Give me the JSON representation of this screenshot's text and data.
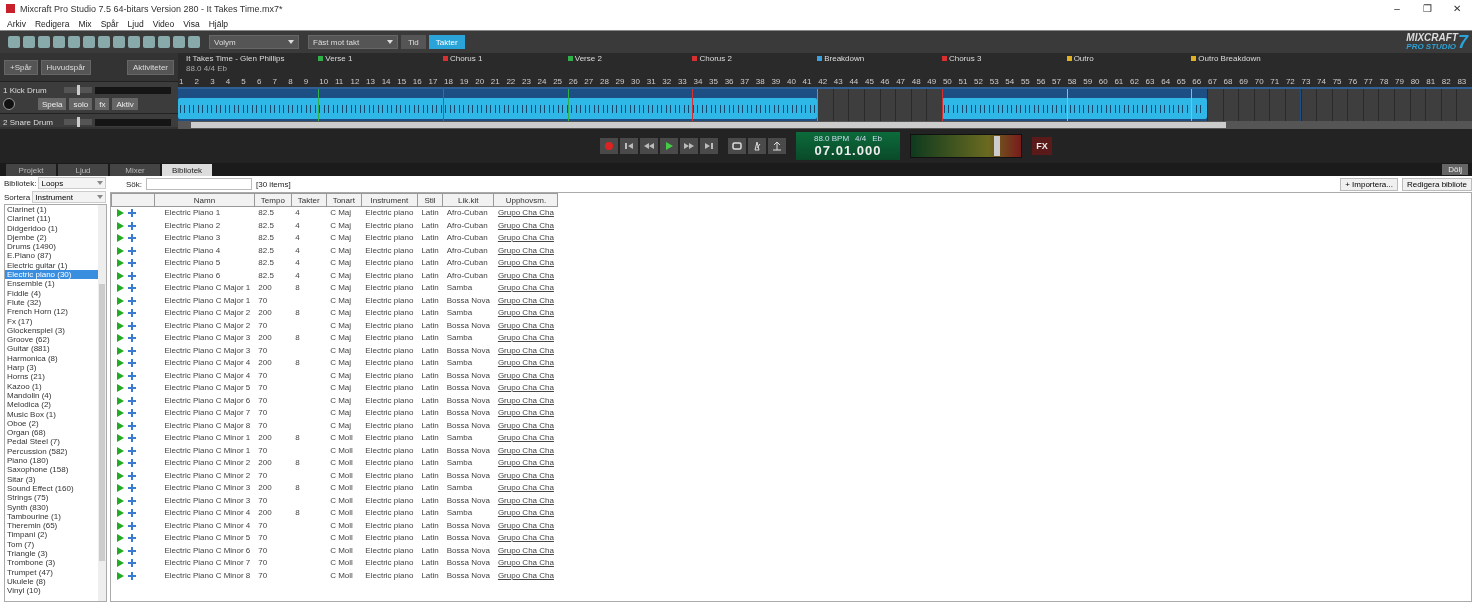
{
  "window": {
    "title": "Mixcraft Pro Studio 7.5 64-bitars Version 280 - It Takes Time.mx7*",
    "controls": [
      "–",
      "❐",
      "✕"
    ]
  },
  "menu": [
    "Arkiv",
    "Redigera",
    "Mix",
    "Spår",
    "Ljud",
    "Video",
    "Visa",
    "Hjälp"
  ],
  "toolbar": {
    "dropdowns": [
      "Volym",
      "Fäst mot takt"
    ],
    "modes": [
      {
        "label": "Tid",
        "selected": false
      },
      {
        "label": "Takter",
        "selected": true
      }
    ],
    "logo": {
      "line1": "MIXCRAFT",
      "line2": "PRO STUDIO",
      "number": "7"
    }
  },
  "track_panel": {
    "buttons": [
      "+Spår",
      "Huvudspår"
    ],
    "activity": "Aktiviteter"
  },
  "tracks": [
    {
      "name": "1 Kick Drum",
      "level": 0.5,
      "buttons": [
        "Spela",
        "solo",
        "fx",
        "Aktiv"
      ]
    },
    {
      "name": "2 Snare Drum",
      "level": 0.5
    }
  ],
  "timeline": {
    "song_title": "It Takes Time - Glen Phillips",
    "song_info": "88.0 4/4 Eb",
    "markers": [
      {
        "label": "Verse 1",
        "color": "#2fb04a"
      },
      {
        "label": "Chorus 1",
        "color": "#d83030"
      },
      {
        "label": "Verse 2",
        "color": "#2fb04a"
      },
      {
        "label": "Chorus 2",
        "color": "#d83030"
      },
      {
        "label": "Breakdown",
        "color": "#3aa0e0"
      },
      {
        "label": "Chorus 3",
        "color": "#d83030"
      },
      {
        "label": "Outro",
        "color": "#e0b020"
      },
      {
        "label": "Outro Breakdown",
        "color": "#e0b020"
      }
    ],
    "ruler": [
      "1",
      "2",
      "3",
      "4",
      "5",
      "6",
      "7",
      "8",
      "9",
      "10",
      "11",
      "12",
      "13",
      "14",
      "15",
      "16",
      "17",
      "18",
      "19",
      "20",
      "21",
      "22",
      "23",
      "24",
      "25",
      "26",
      "27",
      "28",
      "29",
      "30",
      "31",
      "32",
      "33",
      "34",
      "35",
      "36",
      "37",
      "38",
      "39",
      "40",
      "41",
      "42",
      "43",
      "44",
      "45",
      "46",
      "47",
      "48",
      "49",
      "50",
      "51",
      "52",
      "53",
      "54",
      "55",
      "56",
      "57",
      "58",
      "59",
      "60",
      "61",
      "62",
      "63",
      "64",
      "65",
      "66",
      "67",
      "68",
      "69",
      "70",
      "71",
      "72",
      "73",
      "74",
      "75",
      "76",
      "77",
      "78",
      "79",
      "80",
      "81",
      "82",
      "83"
    ]
  },
  "transport": {
    "tempo": "88.0 BPM",
    "meter": "4/4",
    "key": "Eb",
    "time": "07.01.000",
    "master": {
      "level": 0.78
    },
    "fx": "FX"
  },
  "tabs": [
    {
      "label": "Projekt",
      "selected": false
    },
    {
      "label": "Ljud",
      "selected": false
    },
    {
      "label": "Mixer",
      "selected": false
    },
    {
      "label": "Bibliotek",
      "selected": true
    }
  ],
  "hide_button": "Dölj",
  "library": {
    "library_label": "Bibliotek:",
    "library_value": "Loops",
    "sort_label": "Sortera",
    "sort_value": "Instrument",
    "search_label": "Sök:",
    "count": "[30 items]",
    "import": "+ Importera...",
    "edit": "Redigera bibliote",
    "categories": [
      {
        "label": "Clarinet (1)",
        "selected": false
      },
      {
        "label": "Clarinet (11)",
        "selected": false
      },
      {
        "label": "Didgeridoo (1)",
        "selected": false
      },
      {
        "label": "Djembe (2)",
        "selected": false
      },
      {
        "label": "Drums (1490)",
        "selected": false
      },
      {
        "label": "E.Piano (87)",
        "selected": false
      },
      {
        "label": "Electric guitar (1)",
        "selected": false
      },
      {
        "label": "Electric piano (30)",
        "selected": true
      },
      {
        "label": "Ensemble (1)",
        "selected": false
      },
      {
        "label": "Fiddle (4)",
        "selected": false
      },
      {
        "label": "Flute (32)",
        "selected": false
      },
      {
        "label": "French Horn (12)",
        "selected": false
      },
      {
        "label": "Fx (17)",
        "selected": false
      },
      {
        "label": "Glockenspiel (3)",
        "selected": false
      },
      {
        "label": "Groove (62)",
        "selected": false
      },
      {
        "label": "Guitar (881)",
        "selected": false
      },
      {
        "label": "Harmonica (8)",
        "selected": false
      },
      {
        "label": "Harp (3)",
        "selected": false
      },
      {
        "label": "Horns (21)",
        "selected": false
      },
      {
        "label": "Kazoo (1)",
        "selected": false
      },
      {
        "label": "Mandolin (4)",
        "selected": false
      },
      {
        "label": "Melodica (2)",
        "selected": false
      },
      {
        "label": "Music Box (1)",
        "selected": false
      },
      {
        "label": "Oboe (2)",
        "selected": false
      },
      {
        "label": "Organ (68)",
        "selected": false
      },
      {
        "label": "Pedal Steel (7)",
        "selected": false
      },
      {
        "label": "Percussion (582)",
        "selected": false
      },
      {
        "label": "Piano (180)",
        "selected": false
      },
      {
        "label": "Saxophone (158)",
        "selected": false
      },
      {
        "label": "Sitar (3)",
        "selected": false
      },
      {
        "label": "Sound Effect (160)",
        "selected": false
      },
      {
        "label": "Strings (75)",
        "selected": false
      },
      {
        "label": "Synth (830)",
        "selected": false
      },
      {
        "label": "Tambourine (1)",
        "selected": false
      },
      {
        "label": "Theremin (65)",
        "selected": false
      },
      {
        "label": "Timpani (2)",
        "selected": false
      },
      {
        "label": "Tom (7)",
        "selected": false
      },
      {
        "label": "Triangle (3)",
        "selected": false
      },
      {
        "label": "Trombone (3)",
        "selected": false
      },
      {
        "label": "Trumpet (47)",
        "selected": false
      },
      {
        "label": "Ukulele (8)",
        "selected": false
      },
      {
        "label": "Vinyl (10)",
        "selected": false
      }
    ],
    "columns": [
      "Namn",
      "Tempo",
      "Takter",
      "Tonart",
      "Instrument",
      "Stil",
      "Lik.kit",
      "Upphovsm."
    ],
    "rows": [
      [
        "Electric Piano 1",
        "82.5",
        "4",
        "C Maj",
        "Electric piano",
        "Latin",
        "Afro-Cuban",
        "Grupo Cha Cha"
      ],
      [
        "Electric Piano 2",
        "82.5",
        "4",
        "C Maj",
        "Electric piano",
        "Latin",
        "Afro-Cuban",
        "Grupo Cha Cha"
      ],
      [
        "Electric Piano 3",
        "82.5",
        "4",
        "C Maj",
        "Electric piano",
        "Latin",
        "Afro-Cuban",
        "Grupo Cha Cha"
      ],
      [
        "Electric Piano 4",
        "82.5",
        "4",
        "C Maj",
        "Electric piano",
        "Latin",
        "Afro-Cuban",
        "Grupo Cha Cha"
      ],
      [
        "Electric Piano 5",
        "82.5",
        "4",
        "C Maj",
        "Electric piano",
        "Latin",
        "Afro-Cuban",
        "Grupo Cha Cha"
      ],
      [
        "Electric Piano 6",
        "82.5",
        "4",
        "C Maj",
        "Electric piano",
        "Latin",
        "Afro-Cuban",
        "Grupo Cha Cha"
      ],
      [
        "Electric Piano C Major 1",
        "200",
        "8",
        "C Maj",
        "Electric piano",
        "Latin",
        "Samba",
        "Grupo Cha Cha"
      ],
      [
        "Electric Piano C Major 1",
        "70",
        "",
        "C Maj",
        "Electric piano",
        "Latin",
        "Bossa Nova",
        "Grupo Cha Cha"
      ],
      [
        "Electric Piano C Major 2",
        "200",
        "8",
        "C Maj",
        "Electric piano",
        "Latin",
        "Samba",
        "Grupo Cha Cha"
      ],
      [
        "Electric Piano C Major 2",
        "70",
        "",
        "C Maj",
        "Electric piano",
        "Latin",
        "Bossa Nova",
        "Grupo Cha Cha"
      ],
      [
        "Electric Piano C Major 3",
        "200",
        "8",
        "C Maj",
        "Electric piano",
        "Latin",
        "Samba",
        "Grupo Cha Cha"
      ],
      [
        "Electric Piano C Major 3",
        "70",
        "",
        "C Maj",
        "Electric piano",
        "Latin",
        "Bossa Nova",
        "Grupo Cha Cha"
      ],
      [
        "Electric Piano C Major 4",
        "200",
        "8",
        "C Maj",
        "Electric piano",
        "Latin",
        "Samba",
        "Grupo Cha Cha"
      ],
      [
        "Electric Piano C Major 4",
        "70",
        "",
        "C Maj",
        "Electric piano",
        "Latin",
        "Bossa Nova",
        "Grupo Cha Cha"
      ],
      [
        "Electric Piano C Major 5",
        "70",
        "",
        "C Maj",
        "Electric piano",
        "Latin",
        "Bossa Nova",
        "Grupo Cha Cha"
      ],
      [
        "Electric Piano C Major 6",
        "70",
        "",
        "C Maj",
        "Electric piano",
        "Latin",
        "Bossa Nova",
        "Grupo Cha Cha"
      ],
      [
        "Electric Piano C Major 7",
        "70",
        "",
        "C Maj",
        "Electric piano",
        "Latin",
        "Bossa Nova",
        "Grupo Cha Cha"
      ],
      [
        "Electric Piano C Major 8",
        "70",
        "",
        "C Maj",
        "Electric piano",
        "Latin",
        "Bossa Nova",
        "Grupo Cha Cha"
      ],
      [
        "Electric Piano C Minor 1",
        "200",
        "8",
        "C Moll",
        "Electric piano",
        "Latin",
        "Samba",
        "Grupo Cha Cha"
      ],
      [
        "Electric Piano C Minor 1",
        "70",
        "",
        "C Moll",
        "Electric piano",
        "Latin",
        "Bossa Nova",
        "Grupo Cha Cha"
      ],
      [
        "Electric Piano C Minor 2",
        "200",
        "8",
        "C Moll",
        "Electric piano",
        "Latin",
        "Samba",
        "Grupo Cha Cha"
      ],
      [
        "Electric Piano C Minor 2",
        "70",
        "",
        "C Moll",
        "Electric piano",
        "Latin",
        "Bossa Nova",
        "Grupo Cha Cha"
      ],
      [
        "Electric Piano C Minor 3",
        "200",
        "8",
        "C Moll",
        "Electric piano",
        "Latin",
        "Samba",
        "Grupo Cha Cha"
      ],
      [
        "Electric Piano C Minor 3",
        "70",
        "",
        "C Moll",
        "Electric piano",
        "Latin",
        "Bossa Nova",
        "Grupo Cha Cha"
      ],
      [
        "Electric Piano C Minor 4",
        "200",
        "8",
        "C Moll",
        "Electric piano",
        "Latin",
        "Samba",
        "Grupo Cha Cha"
      ],
      [
        "Electric Piano C Minor 4",
        "70",
        "",
        "C Moll",
        "Electric piano",
        "Latin",
        "Bossa Nova",
        "Grupo Cha Cha"
      ],
      [
        "Electric Piano C Minor 5",
        "70",
        "",
        "C Moll",
        "Electric piano",
        "Latin",
        "Bossa Nova",
        "Grupo Cha Cha"
      ],
      [
        "Electric Piano C Minor 6",
        "70",
        "",
        "C Moll",
        "Electric piano",
        "Latin",
        "Bossa Nova",
        "Grupo Cha Cha"
      ],
      [
        "Electric Piano C Minor 7",
        "70",
        "",
        "C Moll",
        "Electric piano",
        "Latin",
        "Bossa Nova",
        "Grupo Cha Cha"
      ],
      [
        "Electric Piano C Minor 8",
        "70",
        "",
        "C Moll",
        "Electric piano",
        "Latin",
        "Bossa Nova",
        "Grupo Cha Cha"
      ]
    ]
  }
}
